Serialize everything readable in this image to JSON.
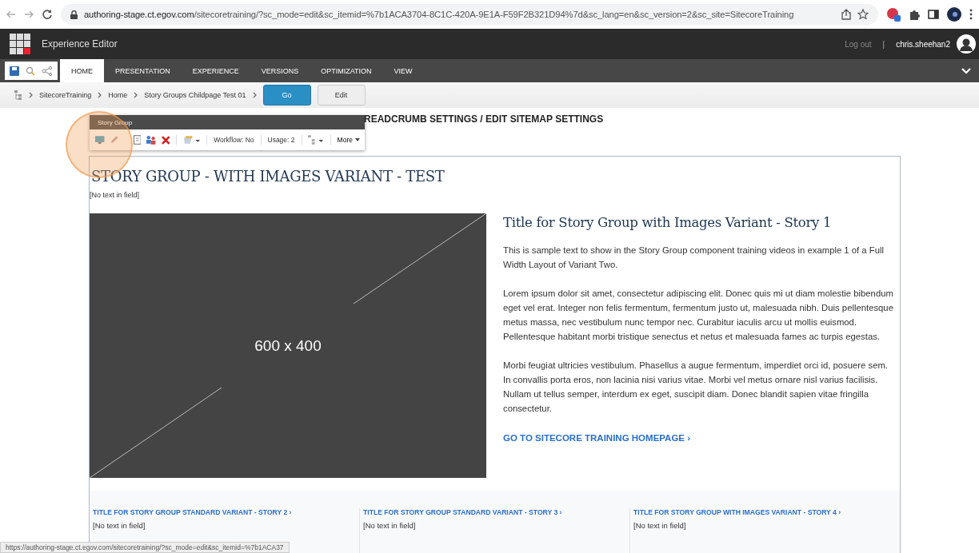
{
  "browser": {
    "url_host": "authoring-stage.ct.egov.com",
    "url_rest": "/sitecoretraining/?sc_mode=edit&sc_itemid=%7b1ACA3704-8C1C-420A-9E1A-F59F2B321D94%7d&sc_lang=en&sc_version=2&sc_site=SitecoreTraining"
  },
  "app": {
    "title": "Experience Editor",
    "logout": "Log out",
    "separator": "|",
    "user": "chris.sheehan2"
  },
  "tabs": [
    {
      "label": "HOME",
      "selected": true
    },
    {
      "label": "PRESENTATION",
      "selected": false
    },
    {
      "label": "EXPERIENCE",
      "selected": false
    },
    {
      "label": "VERSIONS",
      "selected": false
    },
    {
      "label": "OPTIMIZATION",
      "selected": false
    },
    {
      "label": "VIEW",
      "selected": false
    }
  ],
  "breadcrumb": [
    "SitecoreTraining",
    "Home",
    "Story Groups Childpage Test 01"
  ],
  "buttons": [
    {
      "label": "Go",
      "kind": "primary"
    },
    {
      "label": "Edit",
      "kind": "plain"
    }
  ],
  "hidden_heading": "READCRUMB SETTINGS / EDIT SITEMAP SETTINGS",
  "toolbar": {
    "title": "Story Group",
    "workflow": "Workflow: No",
    "usage": "Usage: 2",
    "more": "More"
  },
  "component": {
    "title": "STORY GROUP - WITH IMAGES VARIANT - TEST",
    "subtitle": "[No text in field]",
    "image_label": "600 x 400",
    "story_title": "Title for Story Group with Images Variant - Story 1",
    "paragraphs": [
      "This is sample text to show in the Story Group component training videos in example 1 of a Full Width Layout of Variant Two.",
      "Lorem ipsum dolor sit amet, consectetur adipiscing elit. Donec quis mi ut diam molestie bibendum eget vel erat. Integer non felis fermentum, fermentum justo ut, malesuada nibh. Duis pellentesque metus massa, nec vestibulum nunc tempor nec. Curabitur iaculis arcu ut mollis euismod. Pellentesque habitant morbi tristique senectus et netus et malesuada fames ac turpis egestas.",
      "Morbi feugiat ultricies vestibulum. Phasellus a augue fermentum, imperdiet orci id, posuere sem. In convallis porta eros, non lacinia nisi varius vitae. Morbi vel metus ornare nisl varius facilisis. Nullam ut tellus semper, interdum ex eget, suscipit diam. Donec blandit sapien vitae fringilla consectetur."
    ],
    "link": "GO TO SITECORE TRAINING HOMEPAGE ›"
  },
  "stories": [
    {
      "title": "TITLE FOR STORY GROUP STANDARD VARIANT - STORY 2 ›",
      "text": "[No text in field]"
    },
    {
      "title": "TITLE FOR STORY GROUP STANDARD VARIANT - STORY 3 ›",
      "text": "[No text in field]"
    },
    {
      "title": "TITLE FOR STORY GROUP WITH IMAGES VARIANT - STORY 4 ›",
      "text": "[No text in field]"
    }
  ],
  "status_url": "https://authoring-stage.ct.egov.com/sitecoretraining/?sc_mode=edit&sc_itemid=%7b1ACA37"
}
